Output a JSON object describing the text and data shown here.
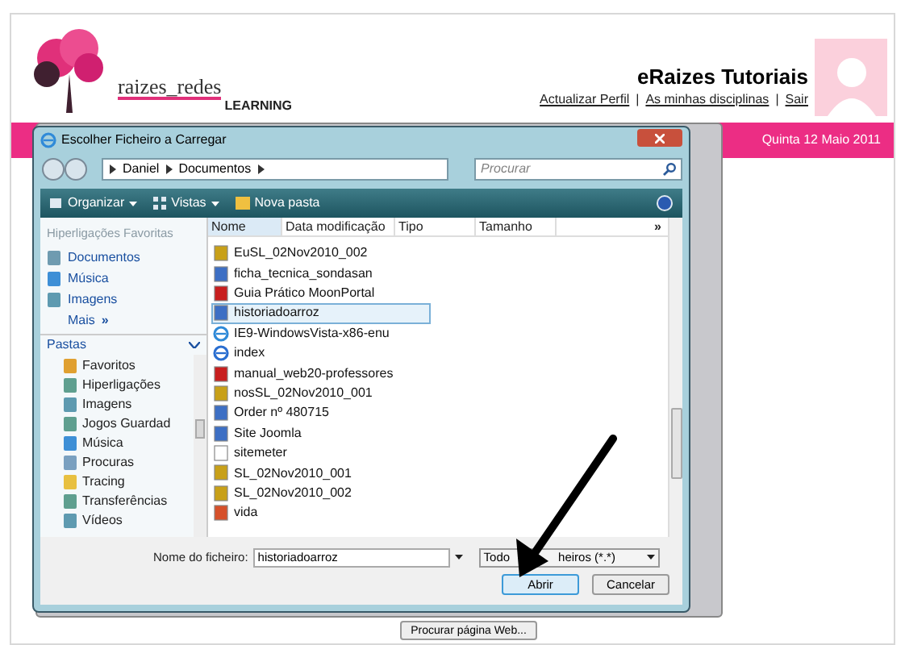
{
  "site": {
    "logo": {
      "name": "raizes_redes",
      "tagline": "LEARNING"
    },
    "title": "eRaizes Tutoriais",
    "links": [
      "Actualizar Perfil",
      "As minhas disciplinas",
      "Sair"
    ],
    "separators": [
      "|",
      "|"
    ],
    "date": "Quinta 12 Maio 2011",
    "button": "Procurar página Web..."
  },
  "dialog": {
    "title": "Escolher Ficheiro a Carregar",
    "breadcrumb": [
      "Daniel",
      "Documentos"
    ],
    "search": {
      "placeholder": "Procurar"
    },
    "toolbar": [
      {
        "label": "Organizar",
        "menu": true,
        "kind": "organize"
      },
      {
        "label": "Vistas",
        "menu": true,
        "kind": "views"
      },
      {
        "label": "Nova pasta",
        "menu": false,
        "kind": "folder"
      }
    ],
    "favorites_title": "Hiperligações Favoritas",
    "favorites": [
      {
        "label": "Documentos",
        "kind": "documents"
      },
      {
        "label": "Música",
        "kind": "music"
      },
      {
        "label": "Imagens",
        "kind": "pictures"
      }
    ],
    "more": {
      "label": "Mais",
      "icon": "»"
    },
    "folders_title": "Pastas",
    "folders": [
      {
        "label": "Favoritos",
        "kind": "favorites"
      },
      {
        "label": "Hiperligações",
        "kind": "folder"
      },
      {
        "label": "Imagens",
        "kind": "pictures"
      },
      {
        "label": "Jogos Guardad",
        "kind": "folder"
      },
      {
        "label": "Música",
        "kind": "music"
      },
      {
        "label": "Procuras",
        "kind": "search"
      },
      {
        "label": "Tracing",
        "kind": "yellow"
      },
      {
        "label": "Transferências",
        "kind": "folder"
      },
      {
        "label": "Vídeos",
        "kind": "pictures"
      }
    ],
    "columns": [
      "Nome",
      "Data modificação",
      "Tipo",
      "Tamanho"
    ],
    "columns_more": "»",
    "files": [
      {
        "name": "EuSL_02Nov2010_002",
        "kind": "video",
        "selected": false
      },
      {
        "name": "ficha_tecnica_sondasan",
        "kind": "word",
        "selected": false
      },
      {
        "name": "Guia Prático MoonPortal",
        "kind": "pdf",
        "selected": false
      },
      {
        "name": "historiadoarroz",
        "kind": "word",
        "selected": true
      },
      {
        "name": "IE9-WindowsVista-x86-enu",
        "kind": "ie",
        "selected": false
      },
      {
        "name": "index",
        "kind": "html",
        "selected": false
      },
      {
        "name": "manual_web20-professores",
        "kind": "pdf",
        "selected": false
      },
      {
        "name": "nosSL_02Nov2010_001",
        "kind": "video",
        "selected": false
      },
      {
        "name": "Order nº 480715",
        "kind": "word",
        "selected": false
      },
      {
        "name": "Site Joomla",
        "kind": "word",
        "selected": false
      },
      {
        "name": "sitemeter",
        "kind": "text",
        "selected": false
      },
      {
        "name": "SL_02Nov2010_001",
        "kind": "video",
        "selected": false
      },
      {
        "name": "SL_02Nov2010_002",
        "kind": "video",
        "selected": false
      },
      {
        "name": "vida",
        "kind": "powerpoint",
        "selected": false
      }
    ],
    "filename_label": "Nome do ficheiro:",
    "filename": "historiadoarroz",
    "filter": [
      "Todo",
      "heiros (*.*)"
    ],
    "buttons": [
      {
        "label": "Abrir",
        "default": true
      },
      {
        "label": "Cancelar",
        "default": false
      }
    ]
  }
}
